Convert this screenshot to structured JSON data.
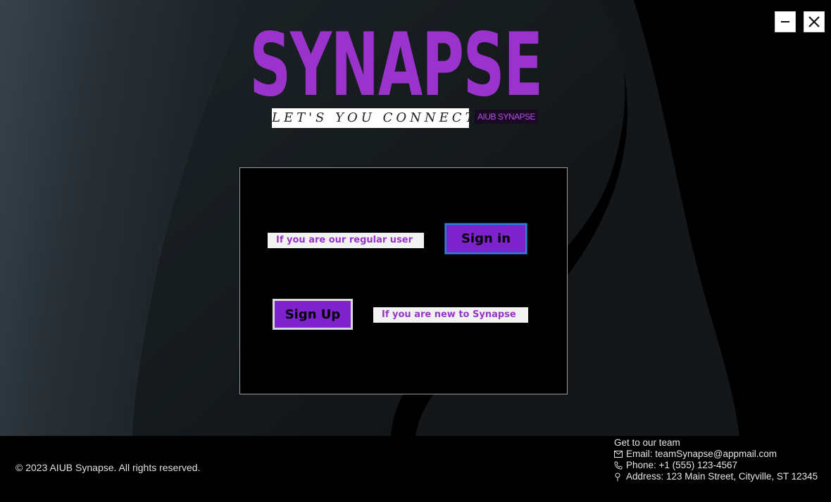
{
  "window": {
    "minimize_glyph": "–",
    "close_glyph": "✕"
  },
  "logo": {
    "title": "SYNAPSE",
    "tagline": "LET'S YOU CONNECT",
    "badge": "AIUB SYNAPSE"
  },
  "panel": {
    "regular_user_note": "If you are our regular user",
    "signin_label": "Sign in",
    "signup_label": "Sign Up",
    "new_user_note": "If you are new to Synapse"
  },
  "footer": {
    "copyright": "© 2023 AIUB Synapse. All rights reserved.",
    "contact_heading": "Get to our team",
    "email": "Email: teamSynapse@appmail.com",
    "phone": "Phone: +1 (555) 123-4567",
    "address": "Address: 123 Main Street, Cityville, ST 12345"
  },
  "colors": {
    "brand_purple": "#9a33cc",
    "button_purple": "#7e22ce",
    "background": "#000000",
    "swoosh": "#2a3238"
  },
  "icons": [
    "minimize-icon",
    "close-icon",
    "email-icon",
    "phone-icon",
    "address-pin-icon"
  ]
}
